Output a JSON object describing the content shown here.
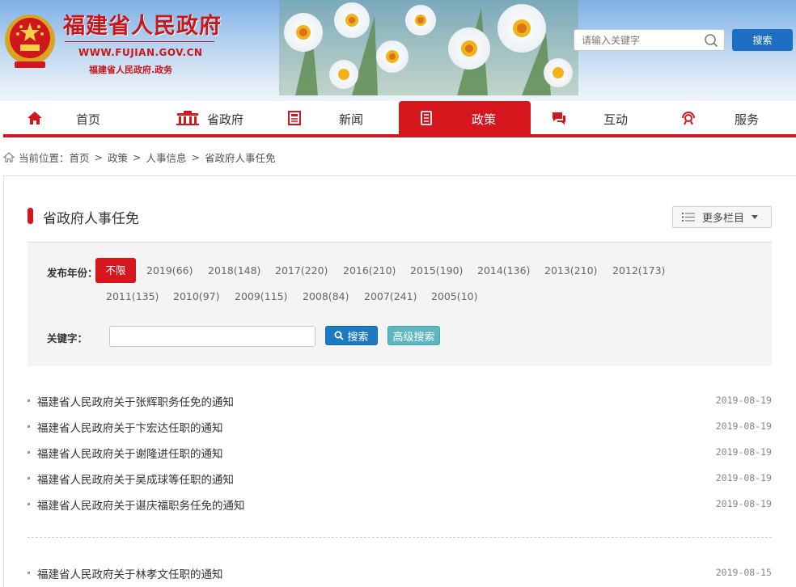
{
  "header": {
    "site_title": "福建省人民政府",
    "site_url": "WWW.FUJIAN.GOV.CN",
    "site_subtitle": "福建省人民政府.政务",
    "search_placeholder": "请输入关键字",
    "search_button": "搜索"
  },
  "nav": {
    "items": [
      {
        "label": "首页",
        "icon": "home-icon"
      },
      {
        "label": "省政府",
        "icon": "building-icon"
      },
      {
        "label": "新闻",
        "icon": "newspaper-icon"
      },
      {
        "label": "政策",
        "icon": "document-icon",
        "active": true
      },
      {
        "label": "互动",
        "icon": "chat-icon"
      },
      {
        "label": "服务",
        "icon": "service-icon"
      }
    ]
  },
  "breadcrumb": {
    "prefix": "当前位置：",
    "items": [
      "首页",
      "政策",
      "人事信息",
      "省政府人事任免"
    ],
    "separator": ">"
  },
  "section": {
    "title": "省政府人事任免",
    "more_label": "更多栏目"
  },
  "filter": {
    "year_label": "发布年份：",
    "years": [
      "不限",
      "2019(66)",
      "2018(148)",
      "2017(220)",
      "2016(210)",
      "2015(190)",
      "2014(136)",
      "2013(210)",
      "2012(173)",
      "2011(135)",
      "2010(97)",
      "2009(115)",
      "2008(84)",
      "2007(241)",
      "2005(10)"
    ],
    "keyword_label": "关键字：",
    "keyword_value": "",
    "search_button": "搜索",
    "advanced_button": "高级搜索"
  },
  "list": [
    {
      "title": "福建省人民政府关于张辉职务任免的通知",
      "date": "2019-08-19"
    },
    {
      "title": "福建省人民政府关于卞宏达任职的通知",
      "date": "2019-08-19"
    },
    {
      "title": "福建省人民政府关于谢隆进任职的通知",
      "date": "2019-08-19"
    },
    {
      "title": "福建省人民政府关于吴成球等任职的通知",
      "date": "2019-08-19"
    },
    {
      "title": "福建省人民政府关于谌庆福职务任免的通知",
      "date": "2019-08-19"
    },
    {
      "title": "福建省人民政府关于林孝文任职的通知",
      "date": "2019-08-15"
    }
  ],
  "colors": {
    "accent": "#d5171d",
    "search_blue": "#1e6fc4",
    "adv_teal": "#5bb8c1"
  }
}
